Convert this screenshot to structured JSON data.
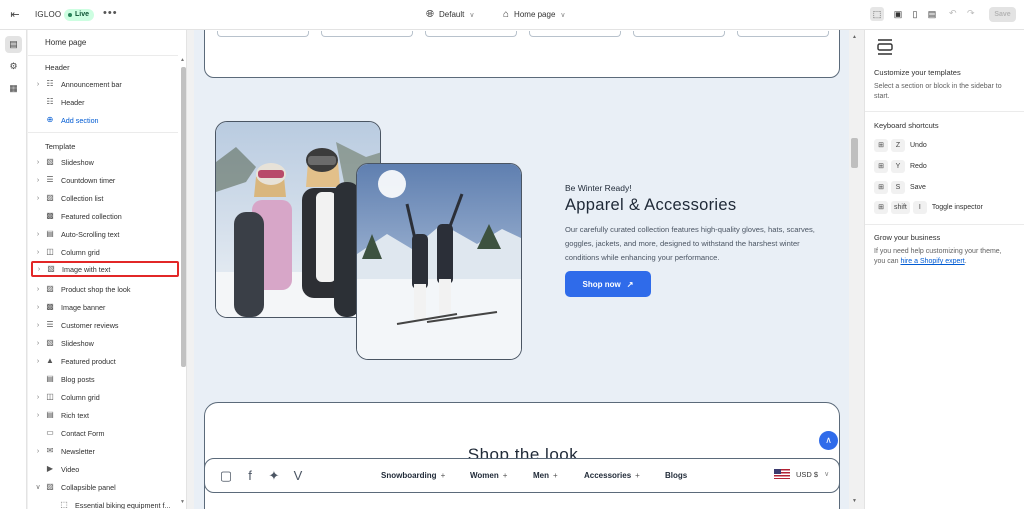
{
  "topbar": {
    "store_name": "IGLOO",
    "live_label": "Live",
    "more_label": "•••",
    "theme_label": "Default",
    "page_label": "Home page",
    "save_label": "Save"
  },
  "sidebar": {
    "title": "Home page",
    "header_group": "Header",
    "header_items": [
      {
        "label": "Announcement bar"
      },
      {
        "label": "Header"
      },
      {
        "label": "Add section"
      }
    ],
    "template_group": "Template",
    "template_items": [
      {
        "label": "Slideshow"
      },
      {
        "label": "Countdown timer"
      },
      {
        "label": "Collection list"
      },
      {
        "label": "Featured collection"
      },
      {
        "label": "Auto-Scrolling text"
      },
      {
        "label": "Column grid"
      },
      {
        "label": "Image with text"
      },
      {
        "label": "Product shop the look"
      },
      {
        "label": "Image banner"
      },
      {
        "label": "Customer reviews"
      },
      {
        "label": "Slideshow"
      },
      {
        "label": "Featured product"
      },
      {
        "label": "Blog posts"
      },
      {
        "label": "Column grid"
      },
      {
        "label": "Rich text"
      },
      {
        "label": "Contact Form"
      },
      {
        "label": "Newsletter"
      },
      {
        "label": "Video"
      },
      {
        "label": "Collapsible panel"
      },
      {
        "label": "Essential biking equipment f..."
      }
    ]
  },
  "preview": {
    "kicker": "Be Winter Ready!",
    "heading": "Apparel & Accessories",
    "paragraph": "Our carefully curated collection features high-quality gloves, hats, scarves, goggles, jackets, and more, designed to withstand the harshest winter conditions while enhancing your performance.",
    "button_label": "Shop now",
    "next_section_title": "Shop the look",
    "nav": [
      {
        "label": "Snowboarding",
        "plus": "+"
      },
      {
        "label": "Women",
        "plus": "+"
      },
      {
        "label": "Men",
        "plus": "+"
      },
      {
        "label": "Accessories",
        "plus": "+"
      },
      {
        "label": "Blogs",
        "plus": ""
      }
    ],
    "currency": "USD $"
  },
  "right_panel": {
    "customize_title": "Customize your templates",
    "customize_text": "Select a section or block in the sidebar to start.",
    "shortcuts_title": "Keyboard shortcuts",
    "shortcuts": [
      {
        "keys": [
          "Z"
        ],
        "label": "Undo"
      },
      {
        "keys": [
          "Y"
        ],
        "label": "Redo"
      },
      {
        "keys": [
          "S"
        ],
        "label": "Save"
      },
      {
        "keys": [
          "shift",
          "I"
        ],
        "label": "Toggle inspector"
      }
    ],
    "grow_title": "Grow your business",
    "grow_text_before": "If you need help customizing your theme, you can",
    "grow_link": "hire a Shopify expert",
    "grow_text_after": "."
  },
  "colors": {
    "accent_blue": "#2f6bea",
    "selection_red": "#e22727",
    "live_green": "#29845a",
    "canvas_bg": "#e9eff6"
  }
}
